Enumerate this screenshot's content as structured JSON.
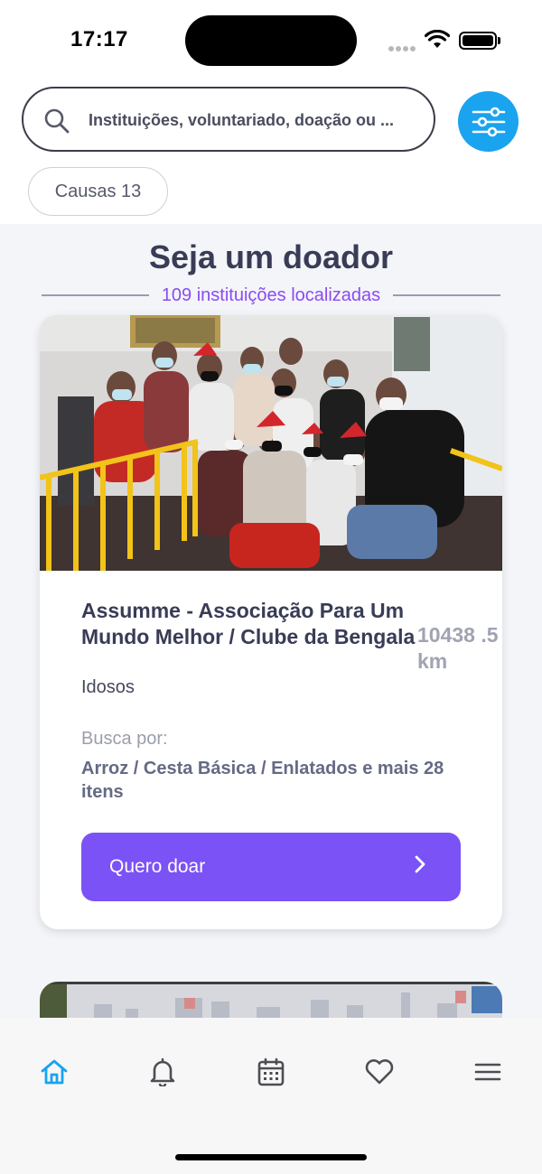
{
  "status_bar": {
    "time": "17:17"
  },
  "search": {
    "placeholder": "Instituições, voluntariado, doação ou ..."
  },
  "filters": {
    "causes_chip": "Causas 13"
  },
  "section": {
    "title": "Seja um doador",
    "subtitle": "109 instituições localizadas"
  },
  "card": {
    "name": "Assumme - Associação Para Um Mundo Melhor / Clube da Bengala",
    "distance": "10438 .5 km",
    "cause": "Idosos",
    "seeks_label": "Busca por:",
    "seeks_items": "Arroz / Cesta Básica / Enlatados e mais 28 itens",
    "donate_label": "Quero doar"
  },
  "nav": {
    "items": [
      {
        "icon": "home-icon",
        "active": true
      },
      {
        "icon": "bell-icon",
        "active": false
      },
      {
        "icon": "calendar-icon",
        "active": false
      },
      {
        "icon": "heart-icon",
        "active": false
      },
      {
        "icon": "menu-icon",
        "active": false
      }
    ]
  },
  "colors": {
    "accent_blue": "#1aa3ef",
    "accent_purple": "#7b52f5",
    "subtitle_purple": "#8a4cf2",
    "title": "#383c56"
  }
}
